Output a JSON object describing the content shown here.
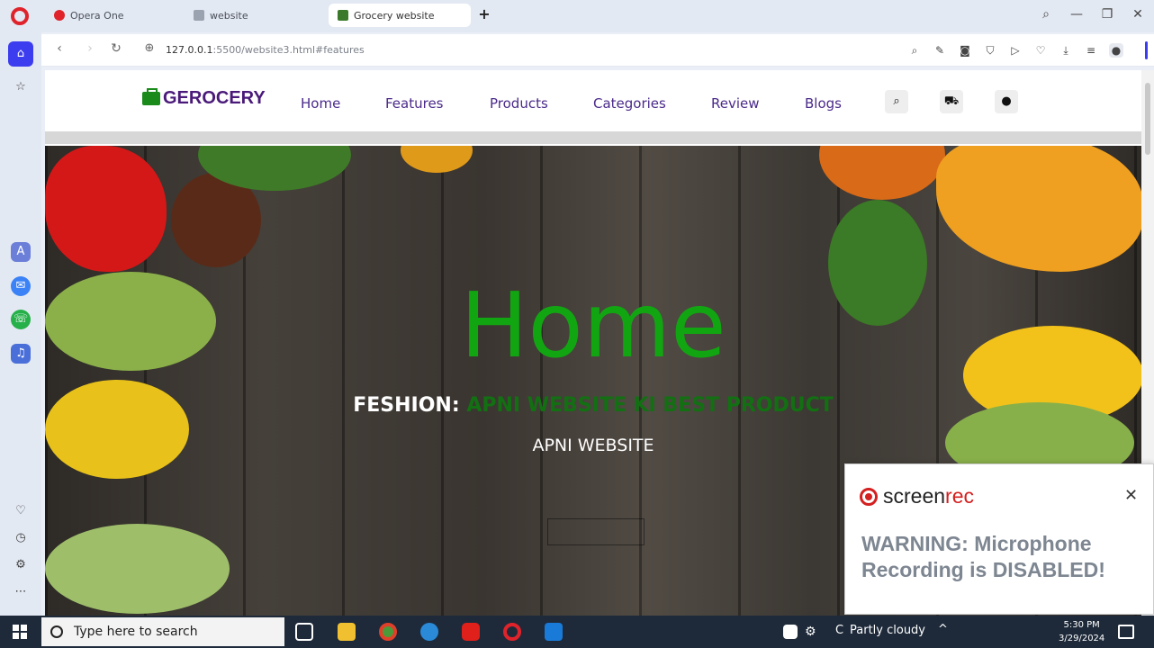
{
  "browser": {
    "tabs": [
      {
        "label": "Opera One"
      },
      {
        "label": "website"
      },
      {
        "label": "Grocery website"
      }
    ],
    "url_host": "127.0.0.1",
    "url_rest": ":5500/website3.html#features"
  },
  "site": {
    "logo": "GEROCERY",
    "nav": [
      "Home",
      "Features",
      "Products",
      "Categories",
      "Review",
      "Blogs"
    ],
    "hero": {
      "title": "Home",
      "sub_white": "FESHION: ",
      "sub_green": "APNI WEBSITE KI BEST PRODUCT",
      "tagline": "APNI WEBSITE"
    }
  },
  "popup": {
    "brand_a": "screen",
    "brand_b": "rec",
    "warning": "WARNING: Microphone Recording is DISABLED!"
  },
  "taskbar": {
    "search_placeholder": "Type here to search",
    "weather_unit": "C",
    "weather": "Partly cloudy",
    "time": "5:30 PM",
    "date": "3/29/2024"
  },
  "colors": {
    "accent_green": "#12a512",
    "nav_purple": "#4a2a8a",
    "opera_red": "#e0232a",
    "rec_red": "#d42020"
  }
}
